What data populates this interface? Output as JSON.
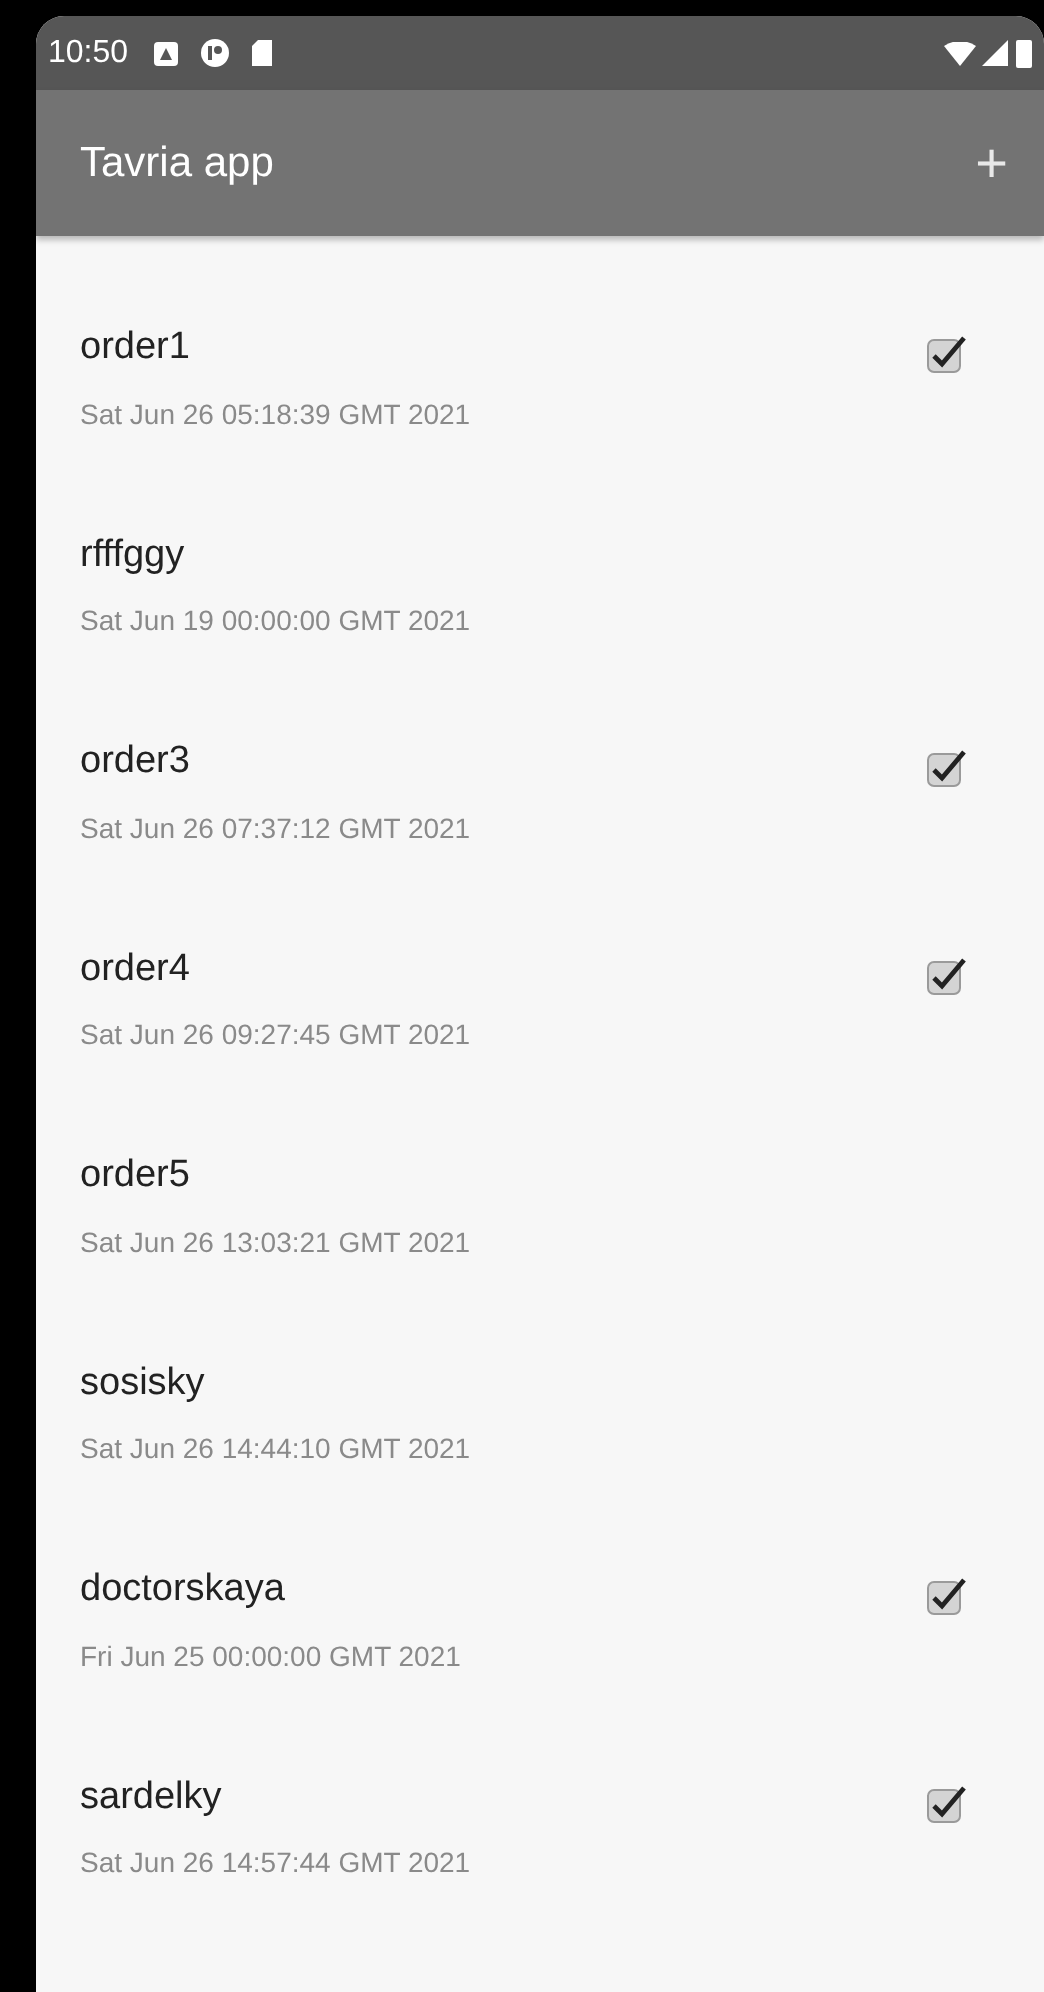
{
  "status_bar": {
    "time": "10:50"
  },
  "app_bar": {
    "title": "Tavria app",
    "add_button": "+"
  },
  "orders": [
    {
      "name": "order1",
      "date": "Sat Jun 26 05:18:39 GMT 2021",
      "checked": true
    },
    {
      "name": "rfffggy",
      "date": "Sat Jun 19 00:00:00 GMT 2021",
      "checked": false
    },
    {
      "name": "order3",
      "date": "Sat Jun 26 07:37:12 GMT 2021",
      "checked": true
    },
    {
      "name": "order4",
      "date": "Sat Jun 26 09:27:45 GMT 2021",
      "checked": true
    },
    {
      "name": "order5",
      "date": "Sat Jun 26 13:03:21 GMT 2021",
      "checked": false
    },
    {
      "name": "sosisky",
      "date": "Sat Jun 26 14:44:10 GMT 2021",
      "checked": false
    },
    {
      "name": "doctorskaya",
      "date": "Fri Jun 25 00:00:00 GMT 2021",
      "checked": true
    },
    {
      "name": "sardelky",
      "date": "Sat Jun 26 14:57:44 GMT 2021",
      "checked": true
    }
  ]
}
